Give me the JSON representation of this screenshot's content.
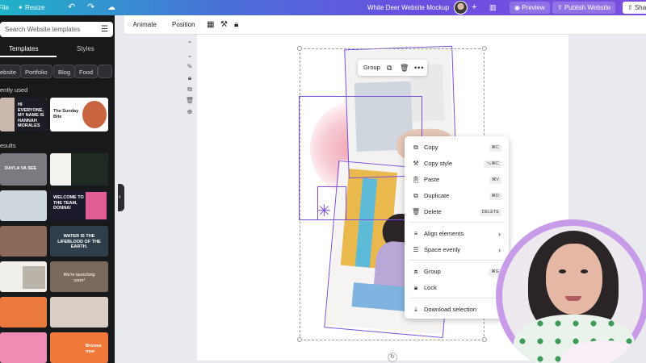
{
  "topbar": {
    "file": "File",
    "resize": "Resize",
    "doc_title": "White Deer Website Mockup",
    "preview": "Preview",
    "publish": "Publish Website",
    "share": "Sha"
  },
  "left_panel": {
    "search_placeholder": "Search Website templates",
    "tabs": [
      "Templates",
      "Styles"
    ],
    "chips": [
      "ebsite",
      "Portfolio",
      "Blog",
      "Food"
    ],
    "recent_heading": "ently used",
    "results_heading": "esults",
    "recent": [
      {
        "text": "HI EVERYONE, MY NAME IS HANNAH MORALES"
      },
      {
        "text": "The Sunday Bite"
      }
    ],
    "results": [
      {
        "text": "DAYLA VA SEE"
      },
      {
        "text": ""
      },
      {
        "text": ""
      },
      {
        "text": "WELCOME TO THE TEAM, DONNA!"
      },
      {
        "text": ""
      },
      {
        "text": "WATER IS THE LIFEBLOOD OF THE EARTH."
      },
      {
        "text": ""
      },
      {
        "text": "We're launching soon!"
      },
      {
        "text": ""
      },
      {
        "text": ""
      },
      {
        "text": ""
      },
      {
        "text": "Browse now"
      }
    ]
  },
  "toolbar": {
    "animate": "Animate",
    "position": "Position"
  },
  "float_bar": {
    "group": "Group"
  },
  "context_menu": {
    "items": [
      {
        "label": "Copy",
        "shortcut": "⌘C",
        "icon": "copy-icon"
      },
      {
        "label": "Copy style",
        "shortcut": "⌥⌘C",
        "icon": "paint-roller-icon"
      },
      {
        "label": "Paste",
        "shortcut": "⌘V",
        "icon": "clipboard-icon"
      },
      {
        "label": "Duplicate",
        "shortcut": "⌘D",
        "icon": "duplicate-icon"
      },
      {
        "label": "Delete",
        "shortcut": "DELETE",
        "icon": "trash-icon"
      },
      {
        "label": "Align elements",
        "shortcut": "",
        "icon": "align-icon"
      },
      {
        "label": "Space evenly",
        "shortcut": "",
        "icon": "space-evenly-icon"
      },
      {
        "label": "Group",
        "shortcut": "⌘G",
        "icon": "group-icon"
      },
      {
        "label": "Lock",
        "shortcut": "",
        "icon": "lock-icon"
      },
      {
        "label": "Download selection",
        "shortcut": "",
        "icon": "download-icon"
      }
    ]
  },
  "colors": {
    "accent": "#7b4fe0",
    "panel_bg": "#18191b",
    "canvas_bg": "#e9eaee"
  }
}
